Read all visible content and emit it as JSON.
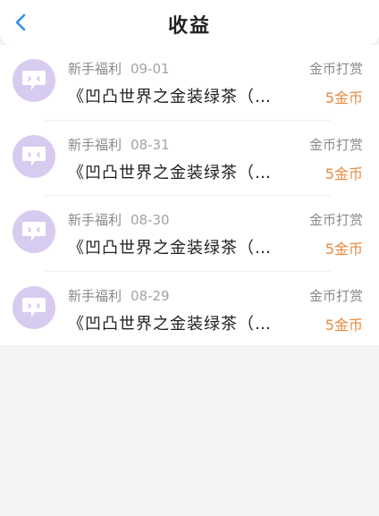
{
  "header": {
    "title": "收益",
    "back_icon": "chevron-left-icon",
    "accent_color": "#2e8ff0"
  },
  "earnings": [
    {
      "category": "新手福利",
      "date": "09-01",
      "title": "《凹凸世界之金装绿茶（…",
      "type": "金币打赏",
      "amount": "5金币",
      "avatar_icon": "chat-bubble-face-icon"
    },
    {
      "category": "新手福利",
      "date": "08-31",
      "title": "《凹凸世界之金装绿茶（…",
      "type": "金币打赏",
      "amount": "5金币",
      "avatar_icon": "chat-bubble-face-icon"
    },
    {
      "category": "新手福利",
      "date": "08-30",
      "title": "《凹凸世界之金装绿茶（…",
      "type": "金币打赏",
      "amount": "5金币",
      "avatar_icon": "chat-bubble-face-icon"
    },
    {
      "category": "新手福利",
      "date": "08-29",
      "title": "《凹凸世界之金装绿茶（…",
      "type": "金币打赏",
      "amount": "5金币",
      "avatar_icon": "chat-bubble-face-icon"
    }
  ],
  "colors": {
    "amount": "#e8893f",
    "avatar_bg": "#d8cbf0"
  }
}
